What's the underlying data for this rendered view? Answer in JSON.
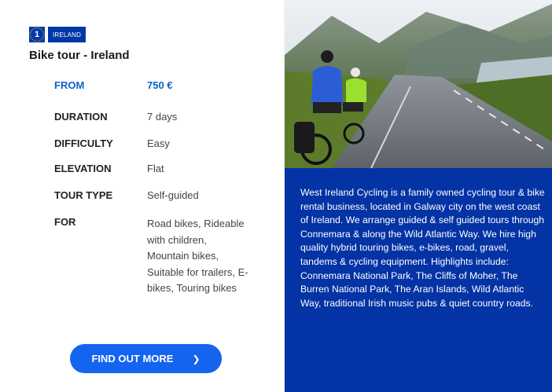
{
  "badge": {
    "number": "1",
    "country": "IRELAND"
  },
  "title": "Bike tour - Ireland",
  "specs": [
    {
      "key": "FROM",
      "value": "750 €"
    },
    {
      "key": "DURATION",
      "value": "7 days"
    },
    {
      "key": "DIFFICULTY",
      "value": "Easy"
    },
    {
      "key": "ELEVATION",
      "value": "Flat"
    },
    {
      "key": "TOUR TYPE",
      "value": "Self-guided"
    },
    {
      "key": "FOR",
      "value": "Road bikes, Rideable with children, Mountain bikes, Suitable for trailers, E-bikes, Touring bikes"
    }
  ],
  "cta": {
    "label": "FIND OUT MORE",
    "icon": "chevron-right-icon"
  },
  "description": "West Ireland Cycling is a family owned cycling tour & bike rental business, located in Galway city on the west coast of Ireland. We arrange guided & self guided tours through Connemara & along the Wild Atlantic Way. We hire high quality hybrid touring bikes, e-bikes, road, gravel, tandems & cycling equipment. Highlights include: Connemara National Park, The Cliffs of Moher, The Burren National Park, The Aran Islands, Wild Atlantic Way, traditional Irish music pubs & quiet country roads.",
  "colors": {
    "brand_blue": "#0333a4",
    "cta_blue": "#1464f0",
    "from_blue": "#0d5fd0"
  }
}
